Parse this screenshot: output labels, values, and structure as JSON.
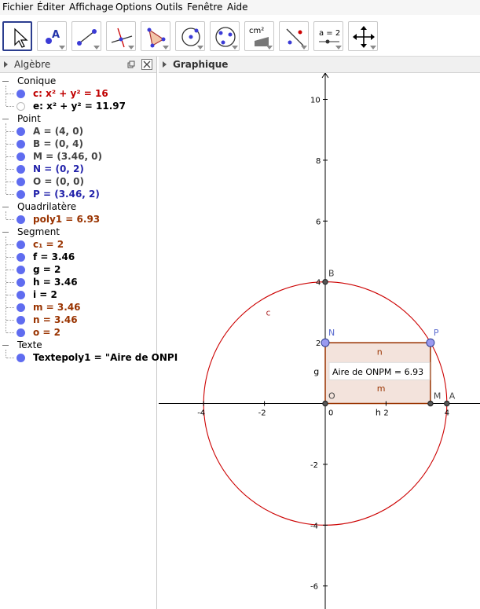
{
  "menu": [
    "Fichier",
    "Éditer",
    "Affichage",
    "Options",
    "Outils",
    "Fenêtre",
    "Aide"
  ],
  "toolbar": {
    "tools": [
      "move-tool",
      "point-tool",
      "line-tool",
      "perpendicular-tool",
      "polygon-tool",
      "circle-tool",
      "conic-tool",
      "area-tool",
      "reflect-tool",
      "slider-tool",
      "pan-tool"
    ],
    "area_label": "cm²",
    "slider_label": "a = 2"
  },
  "algebra": {
    "title": "Algèbre",
    "categories": [
      {
        "name": "Conique",
        "items": [
          {
            "text": "c: x² + y² = 16",
            "color": "#c00000"
          },
          {
            "text": "e: x² + y² = 11.97",
            "color": "#000000",
            "hidden": true
          }
        ]
      },
      {
        "name": "Point",
        "items": [
          {
            "text": "A = (4, 0)",
            "color": "#444444"
          },
          {
            "text": "B = (0, 4)",
            "color": "#444444"
          },
          {
            "text": "M = (3.46, 0)",
            "color": "#444444"
          },
          {
            "text": "N = (0, 2)",
            "color": "#2222aa"
          },
          {
            "text": "O = (0, 0)",
            "color": "#444444"
          },
          {
            "text": "P = (3.46, 2)",
            "color": "#2222aa"
          }
        ]
      },
      {
        "name": "Quadrilatère",
        "items": [
          {
            "text": "poly1 = 6.93",
            "color": "#993300"
          }
        ]
      },
      {
        "name": "Segment",
        "items": [
          {
            "text": "c₁ = 2",
            "color": "#993300"
          },
          {
            "text": "f = 3.46",
            "color": "#000000"
          },
          {
            "text": "g = 2",
            "color": "#000000"
          },
          {
            "text": "h = 3.46",
            "color": "#000000"
          },
          {
            "text": "i = 2",
            "color": "#000000"
          },
          {
            "text": "m = 3.46",
            "color": "#993300"
          },
          {
            "text": "n = 3.46",
            "color": "#993300"
          },
          {
            "text": "o = 2",
            "color": "#993300"
          }
        ]
      },
      {
        "name": "Texte",
        "items": [
          {
            "text": "Textepoly1 = \"Aire de  ONPI",
            "color": "#000000"
          }
        ]
      }
    ]
  },
  "graphics": {
    "title": "Graphique",
    "x_ticks": [
      "-4",
      "-2",
      "2",
      "4"
    ],
    "y_ticks": [
      "10",
      "8",
      "6",
      "4",
      "2",
      "-2",
      "-4",
      "-6"
    ],
    "origin_label": "0",
    "circle_c": {
      "radius": 4,
      "label": "c",
      "color": "#cc0000"
    },
    "points": [
      {
        "name": "B",
        "x": 0,
        "y": 4
      },
      {
        "name": "N",
        "x": 0,
        "y": 2
      },
      {
        "name": "P",
        "x": 3.46,
        "y": 2
      },
      {
        "name": "O",
        "x": 0,
        "y": 0
      },
      {
        "name": "M",
        "x": 3.46,
        "y": 0
      },
      {
        "name": "A",
        "x": 4,
        "y": 0
      }
    ],
    "segment_labels": {
      "top": "n",
      "bottom": "m",
      "left": "g",
      "axis": "h"
    },
    "area_text": "Aire de  ONPM = 6.93"
  }
}
